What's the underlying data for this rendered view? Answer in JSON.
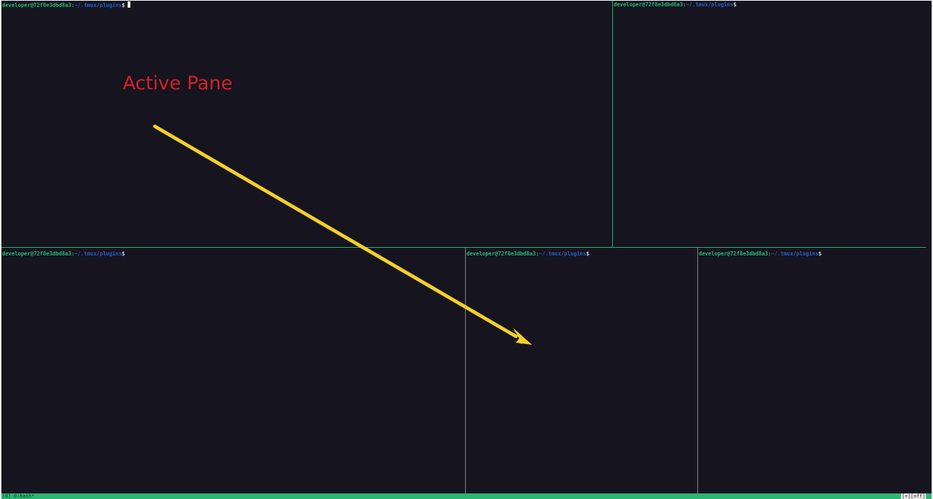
{
  "prompt": {
    "user_host": "developer@72f8e3dbd8a3",
    "separator": ":",
    "path": "~/.tmux/plugins",
    "dollar": "$"
  },
  "panes": [
    {
      "id": "top-left",
      "active": true
    },
    {
      "id": "top-right",
      "active": false
    },
    {
      "id": "bottom-left",
      "active": false
    },
    {
      "id": "bottom-middle",
      "active": false
    },
    {
      "id": "bottom-right",
      "active": false
    }
  ],
  "statusbar": {
    "session_window": "[0] 0:bash*",
    "right_indicator": "[+][off]"
  },
  "annotation": {
    "label": "Active Pane"
  },
  "colors": {
    "terminal_bg": "#15141f",
    "prompt_user": "#2bb673",
    "prompt_path": "#2a5cc6",
    "statusbar_bg": "#2bb673",
    "active_border": "#2bb673",
    "inactive_border": "#8a8a8a",
    "annotation_text": "#d42027",
    "arrow": "#f4d026"
  }
}
